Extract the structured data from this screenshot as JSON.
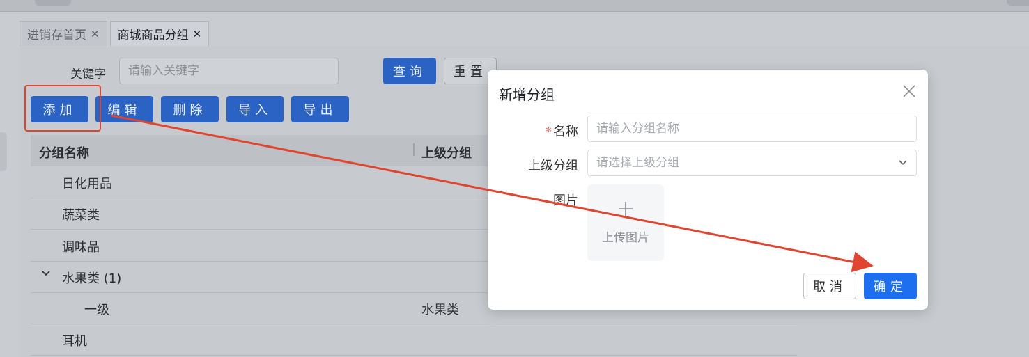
{
  "tabs": [
    {
      "label": "进销存首页",
      "close": "✕"
    },
    {
      "label": "商城商品分组",
      "close": "✕"
    }
  ],
  "search": {
    "label": "关键字",
    "placeholder": "请输入关键字",
    "query_button": "查询",
    "reset_button": "重置"
  },
  "toolbar": {
    "add": "添加",
    "edit": "编辑",
    "delete": "删除",
    "import": "导入",
    "export": "导出"
  },
  "table": {
    "columns": [
      "分组名称",
      "上级分组"
    ],
    "rows": [
      {
        "name": "日化用品",
        "parent": ""
      },
      {
        "name": "蔬菜类",
        "parent": ""
      },
      {
        "name": "调味品",
        "parent": ""
      },
      {
        "name": "水果类 (1)",
        "parent": "",
        "expanded": true
      },
      {
        "name": "一级",
        "parent": "水果类"
      },
      {
        "name": "耳机",
        "parent": ""
      }
    ]
  },
  "dialog": {
    "title": "新增分组",
    "fields": {
      "name_label": "名称",
      "name_required": "*",
      "name_placeholder": "请输入分组名称",
      "parent_label": "上级分组",
      "parent_placeholder": "请选择上级分组",
      "image_label": "图片",
      "upload_text": "上传图片"
    },
    "cancel": "取消",
    "confirm": "确定"
  },
  "colors": {
    "primary": "#1e6ff0",
    "annotation": "#e0452f"
  }
}
